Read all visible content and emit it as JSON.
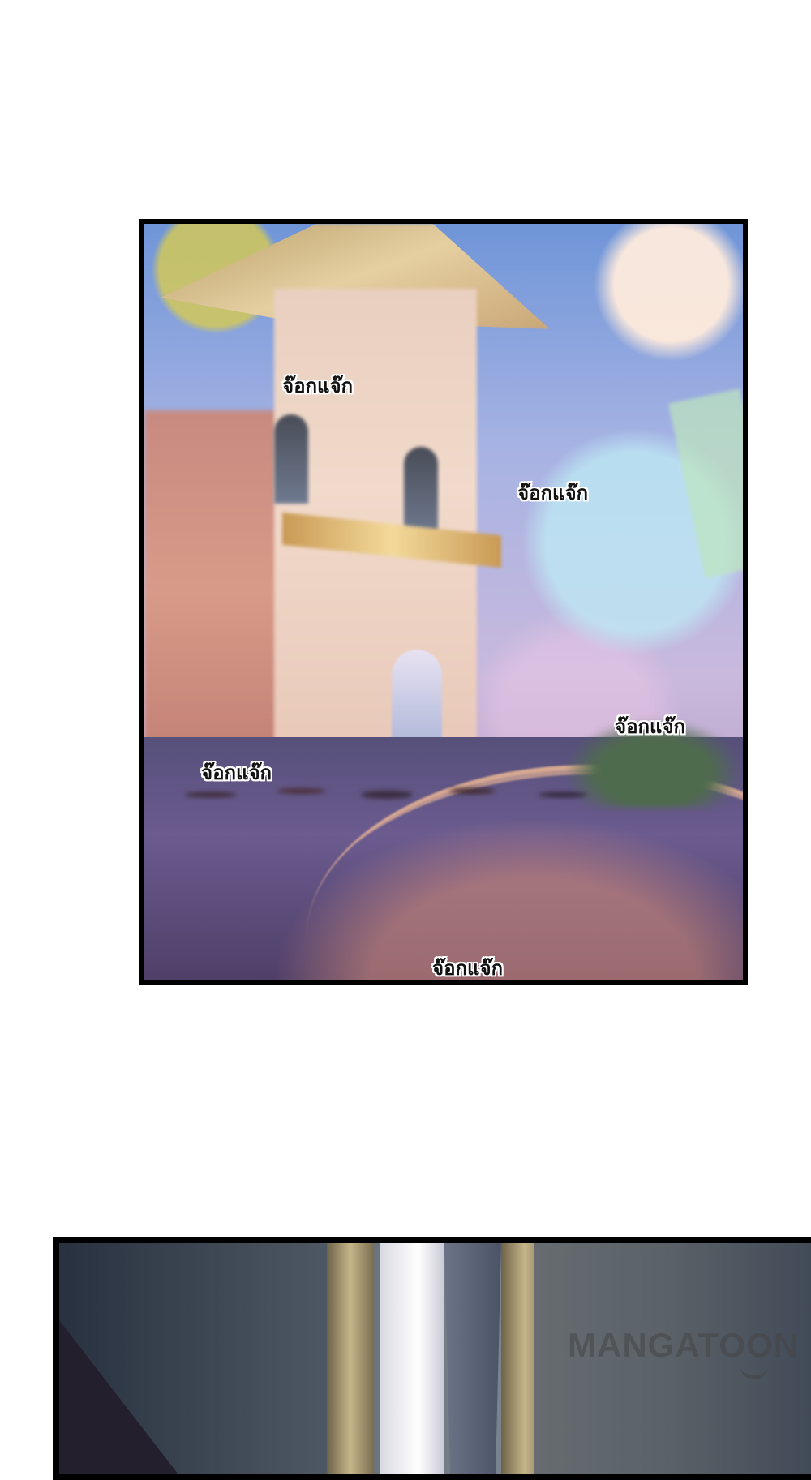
{
  "panels": [
    {
      "id": "palace-scene",
      "sound_effects": [
        "จ๊อกแจ๊ก",
        "จ๊อกแจ๊ก",
        "จ๊อกแจ๊ก",
        "จ๊อกแจ๊ก",
        "จ๊อกแจ๊ก"
      ]
    },
    {
      "id": "corridor-scene"
    }
  ],
  "watermark": {
    "text": "MANGATOON"
  },
  "colors": {
    "page_background": "#ffffff",
    "panel_border": "#000000",
    "sfx_text": "#111111",
    "sfx_outline": "#ffffff"
  }
}
